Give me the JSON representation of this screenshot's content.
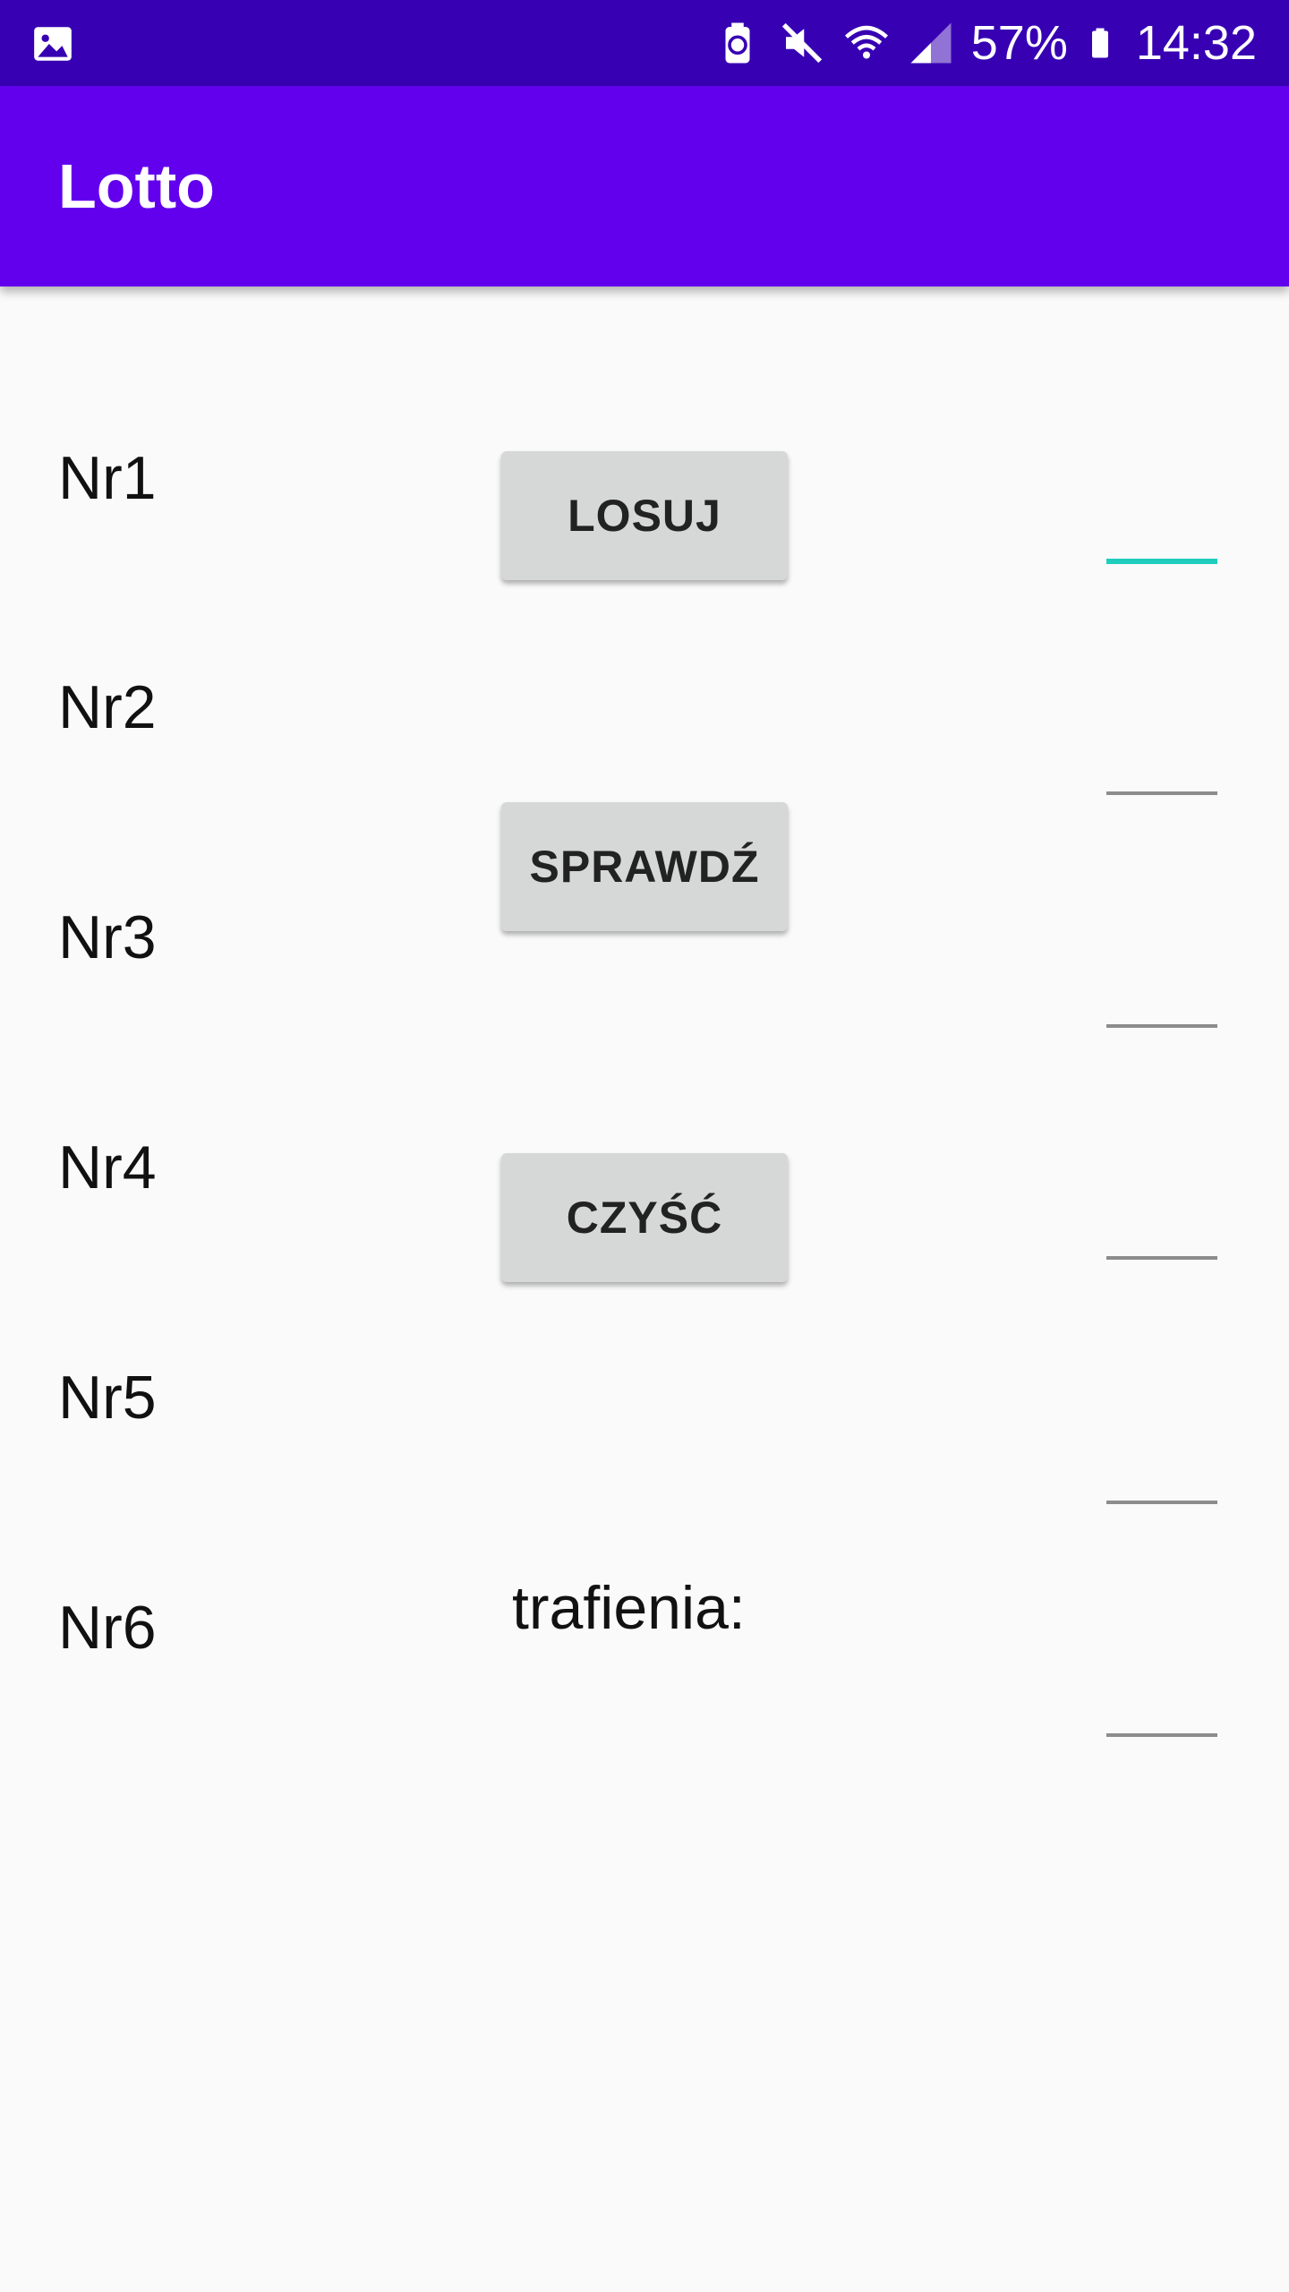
{
  "status_bar": {
    "left_icon": "image-icon",
    "icons": [
      "battery-saver-icon",
      "mute-icon",
      "wifi-icon",
      "signal-icon"
    ],
    "battery_percent": "57%",
    "time": "14:32"
  },
  "app_bar": {
    "title": "Lotto"
  },
  "labels": [
    "Nr1",
    "Nr2",
    "Nr3",
    "Nr4",
    "Nr5",
    "Nr6"
  ],
  "buttons": {
    "draw": "LOSUJ",
    "check": "SPRAWDŹ",
    "clear": "CZYŚĆ"
  },
  "result_label": "trafienia:",
  "inputs": {
    "focused_index": 0,
    "values": [
      "",
      "",
      "",
      "",
      "",
      ""
    ]
  },
  "colors": {
    "status_bar": "#3700b3",
    "app_bar": "#6200ee",
    "accent": "#1ecdbd",
    "button_bg": "#d6d7d7",
    "background": "#fafafa"
  }
}
